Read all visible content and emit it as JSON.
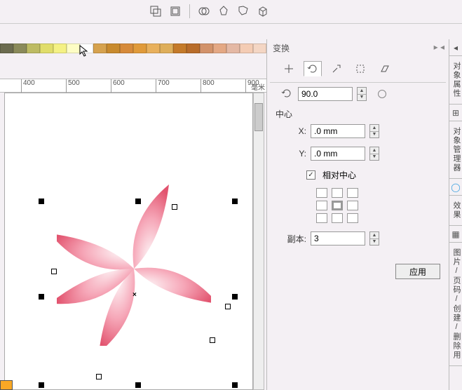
{
  "toolbar": {
    "icons": [
      "group",
      "ungroup",
      "weld",
      "trim",
      "intersect",
      "cube"
    ]
  },
  "palette": [
    "#6b6b4f",
    "#8a8a5a",
    "#bdbb63",
    "#e0dd6a",
    "#f4f184",
    "#fdfdc4",
    "#fefefe",
    "#d6a24e",
    "#c88a2e",
    "#d68a3a",
    "#e09a3a",
    "#e8b05c",
    "#deae5a",
    "#c47a2a",
    "#b86c2a",
    "#d2926a",
    "#e4a884",
    "#e4b8a4",
    "#f4ccb4",
    "#f4d6c4"
  ],
  "ruler": {
    "ticks": [
      400,
      500,
      600,
      700,
      800,
      900
    ],
    "unit": "毫米"
  },
  "docker": {
    "title": "变换",
    "tabs": [
      "position",
      "rotate",
      "scale",
      "size",
      "skew"
    ],
    "rotate": {
      "angle_label": "",
      "angle": "90.0"
    },
    "center": {
      "label": "中心",
      "x_label": "X:",
      "x": ".0 mm",
      "y_label": "Y:",
      "y": ".0 mm",
      "relative": "相对中心",
      "relative_checked": true
    },
    "copies": {
      "label": "副本:",
      "value": "3"
    },
    "apply": "应用"
  },
  "right_tabs": [
    "对象属性",
    "对象管理器",
    "效果",
    "图片/页码/创建/删除用"
  ]
}
